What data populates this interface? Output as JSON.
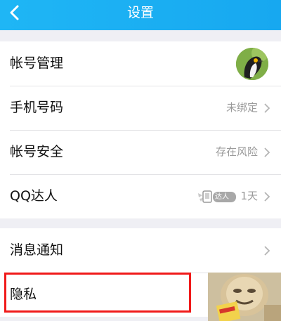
{
  "header": {
    "title": "设置"
  },
  "group1": [
    {
      "label": "帐号管理"
    },
    {
      "label": "手机号码",
      "value": "未绑定"
    },
    {
      "label": "帐号安全",
      "value": "存在风险"
    },
    {
      "label": "QQ达人",
      "badge_text": "达人",
      "value": "1天"
    }
  ],
  "group2": [
    {
      "label": "消息通知"
    },
    {
      "label": "隐私"
    }
  ],
  "colors": {
    "header": "#1fb6f5",
    "highlight_border": "#f01a1a",
    "page_bg": "#efeff4"
  },
  "icons": [
    "back-icon",
    "chevron-right-icon",
    "avatar-penguin",
    "qq-daren-badge-icon",
    "meme-sticker"
  ]
}
